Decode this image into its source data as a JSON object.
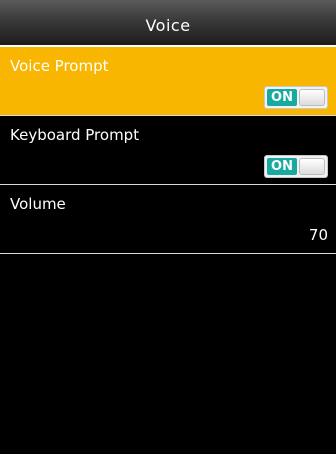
{
  "header": {
    "title": "Voice"
  },
  "settings": [
    {
      "label": "Voice Prompt",
      "toggle": "ON",
      "selected": true
    },
    {
      "label": "Keyboard Prompt",
      "toggle": "ON",
      "selected": false
    },
    {
      "label": "Volume",
      "value": "70",
      "selected": false
    }
  ],
  "colors": {
    "selected_background": "#f8b600",
    "toggle_on": "#18a9a0",
    "background": "#000000"
  }
}
